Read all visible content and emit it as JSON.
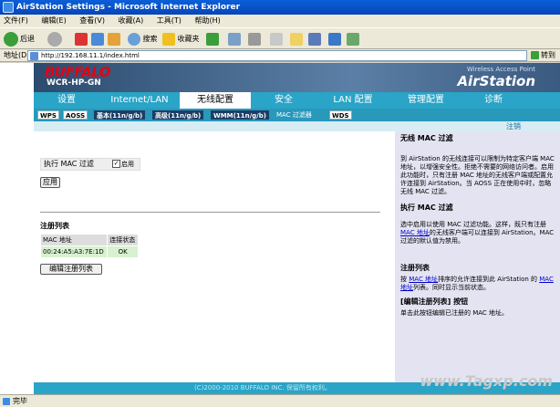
{
  "window": {
    "title": "AirStation Settings - Microsoft Internet Explorer"
  },
  "menu": [
    "文件(F)",
    "编辑(E)",
    "查看(V)",
    "收藏(A)",
    "工具(T)",
    "帮助(H)"
  ],
  "toolbar": {
    "back": "后退",
    "search": "搜索",
    "favorites": "收藏夹"
  },
  "address": {
    "label": "地址(D)",
    "url": "http://192.168.11.1/index.html",
    "go": "转到"
  },
  "router": {
    "logo": "BUFFALO",
    "model": "WCR-HP-GN",
    "product_line": "Wireless Access Point",
    "brand": "AirStation"
  },
  "tabs": [
    "设置",
    "Internet/LAN",
    "无线配置",
    "安全",
    "LAN 配置",
    "管理配置",
    "诊断"
  ],
  "subtabs": [
    "WPS",
    "AOSS",
    "基本(11n/g/b)",
    "高级(11n/g/b)",
    "WMM(11n/g/b)",
    "MAC 过滤器",
    "WDS"
  ],
  "logout": "注销",
  "main": {
    "mac_filter_label": "执行 MAC 过滤",
    "enable_label": "启用",
    "apply_button": "应用",
    "reg_list_heading": "注册列表",
    "table_headers": [
      "MAC 地址",
      "连接状态"
    ],
    "table_rows": [
      {
        "mac": "00:24:A5:A3:7E:1D",
        "status": "OK"
      }
    ],
    "edit_button": "编辑注册列表"
  },
  "help": {
    "title": "无线 MAC 过滤",
    "p1": "到 AirStation 的无线连接可以限制为特定客户端 MAC 地址，以增强安全性。拒绝不需要的网络访问者。启用此功能时，只有注册 MAC 地址的无线客户端或配置允许连接到 AirStation。当 AOSS 正在使用中时，忽略无线 MAC 过滤。",
    "h2": "执行 MAC 过滤",
    "p2a": "选中启用以使用 MAC 过滤功能。这样，既只有注册 ",
    "p2link": "MAC 地址",
    "p2b": "的无线客户端可以连接到 AirStation。MAC 过滤的默认值为禁用。",
    "h3": "注册列表",
    "p3a": "按 ",
    "p3link1": "MAC 地址",
    "p3b": "排序的允许连接到此 AirStation 的 ",
    "p3link2": "MAC 地址",
    "p3c": "列表。同时显示当前状态。",
    "h4": "[编辑注册列表] 按钮",
    "p4": "单击此按钮编辑已注册的 MAC 地址。"
  },
  "footer": "(C)2000-2010 BUFFALO INC. 保留所有权利。",
  "status": "完毕",
  "watermark": "www.Tagxp.com"
}
